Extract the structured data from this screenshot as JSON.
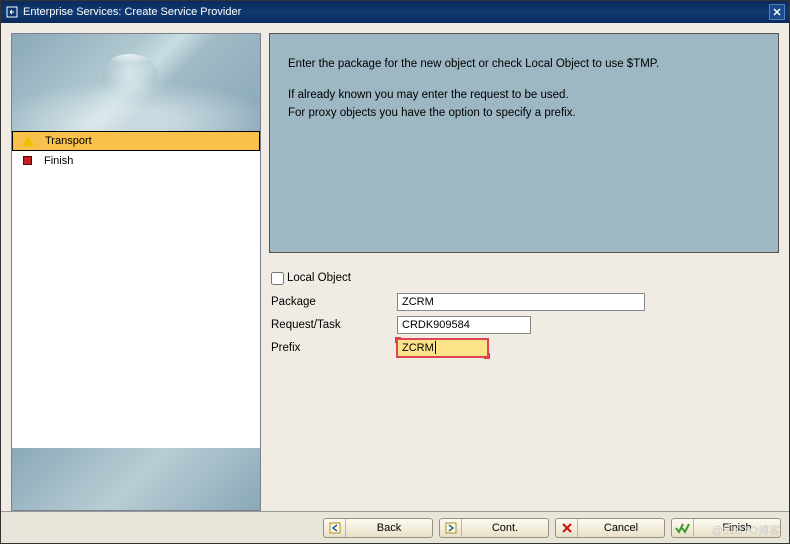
{
  "window": {
    "title": "Enterprise Services: Create Service Provider"
  },
  "sidebar": {
    "items": [
      {
        "label": "Transport",
        "active": true
      },
      {
        "label": "Finish",
        "active": false
      }
    ]
  },
  "instructions": {
    "line1": "Enter the package for the new object or check Local Object to use $TMP.",
    "line2": "If already known you may enter the request to be used.",
    "line3": "For proxy objects you have the option to specify a prefix."
  },
  "form": {
    "local_object_label": "Local Object",
    "local_object_checked": false,
    "package_label": "Package",
    "package_value": "ZCRM",
    "request_label": "Request/Task",
    "request_value": "CRDK909584",
    "prefix_label": "Prefix",
    "prefix_value": "ZCRM"
  },
  "buttons": {
    "back": "Back",
    "cont": "Cont.",
    "cancel": "Cancel",
    "finish": "Finish"
  },
  "watermark": "@51CTO博客"
}
